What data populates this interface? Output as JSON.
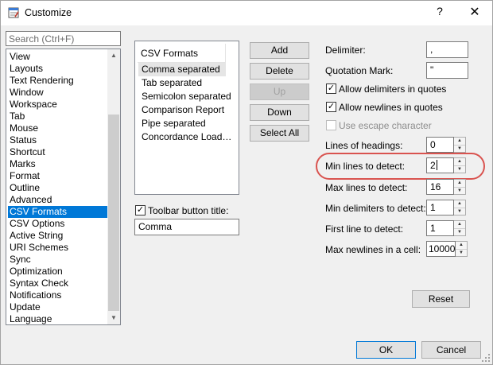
{
  "window": {
    "title": "Customize",
    "help_glyph": "?",
    "close_glyph": "✕"
  },
  "search": {
    "placeholder": "Search (Ctrl+F)"
  },
  "categories": [
    "View",
    "Layouts",
    "Text Rendering",
    "Window",
    "Workspace",
    "Tab",
    "Mouse",
    "Status",
    "Shortcut",
    "Marks",
    "Format",
    "Outline",
    "Advanced",
    "CSV Formats",
    "CSV Options",
    "Active String",
    "URI Schemes",
    "Sync",
    "Optimization",
    "Syntax Check",
    "Notifications",
    "Update",
    "Language"
  ],
  "csv_formats": {
    "header": "CSV Formats",
    "items": [
      "Comma separated",
      "Tab separated",
      "Semicolon separated",
      "Comparison Report",
      "Pipe separated",
      "Concordance Load…"
    ]
  },
  "buttons": {
    "add": "Add",
    "delete": "Delete",
    "up": "Up",
    "down": "Down",
    "select_all": "Select All",
    "reset": "Reset",
    "ok": "OK",
    "cancel": "Cancel"
  },
  "toolbar_title": {
    "label": "Toolbar button title:",
    "value": "Comma"
  },
  "delimiter": {
    "label": "Delimiter:",
    "value": ","
  },
  "quotation": {
    "label": "Quotation Mark:",
    "value": "\""
  },
  "checks": {
    "allow_delims": "Allow delimiters in quotes",
    "allow_newlines": "Allow newlines in quotes",
    "escape": "Use escape character"
  },
  "spinners": {
    "headings": {
      "label": "Lines of headings:",
      "value": "0"
    },
    "min_lines": {
      "label": "Min lines to detect:",
      "value": "2"
    },
    "max_lines": {
      "label": "Max lines to detect:",
      "value": "16"
    },
    "min_delims": {
      "label": "Min delimiters to detect:",
      "value": "1"
    },
    "first_line": {
      "label": "First line to detect:",
      "value": "1"
    },
    "max_newlines": {
      "label": "Max newlines in a cell:",
      "value": "10000"
    }
  },
  "glyphs": {
    "check": "✓",
    "arrow_up": "▲",
    "arrow_down": "▼"
  },
  "colors": {
    "selection": "#0078d7",
    "highlight": "#d9534f"
  }
}
